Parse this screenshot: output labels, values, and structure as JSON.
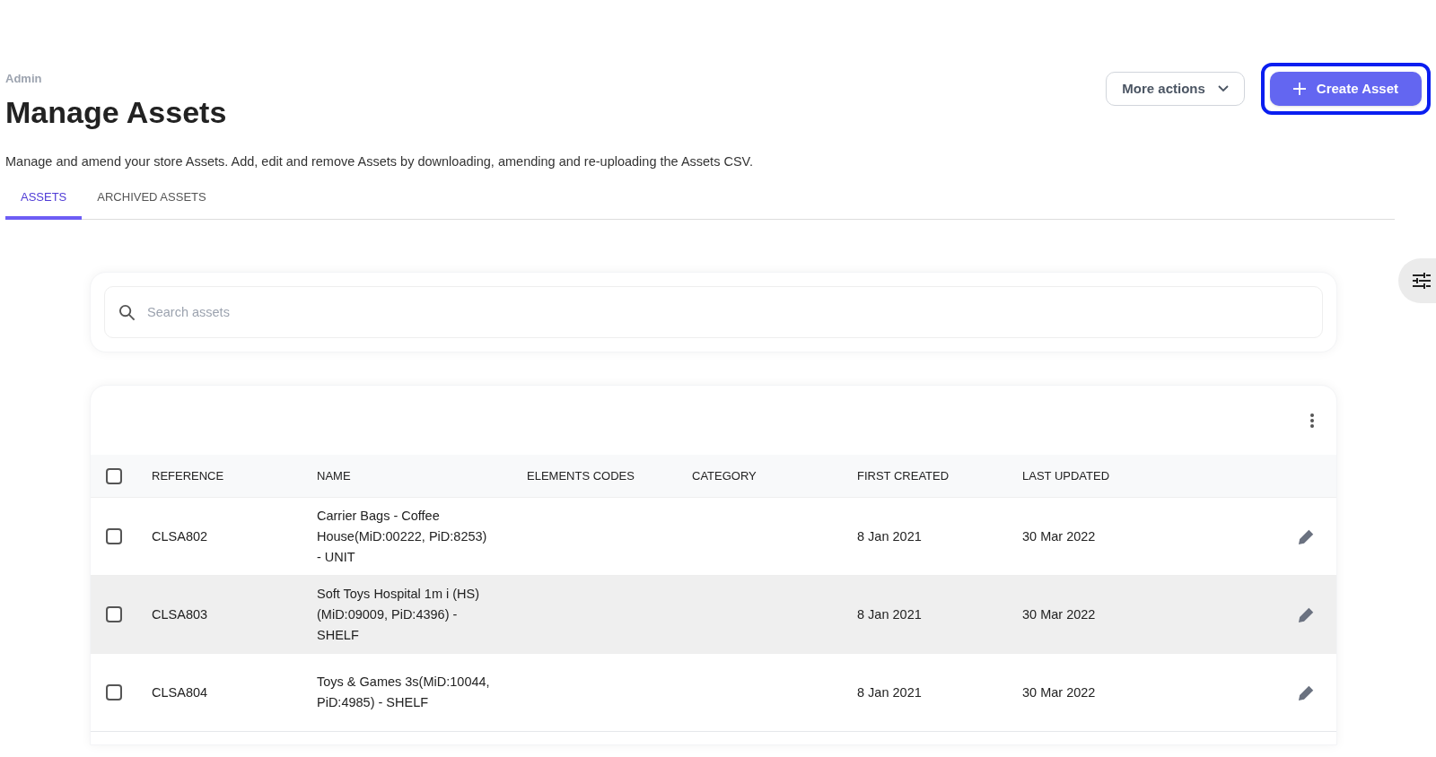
{
  "breadcrumb": "Admin",
  "title": "Manage Assets",
  "description": "Manage and amend your store Assets. Add, edit and remove Assets by downloading, amending and re-uploading the Assets CSV.",
  "actions": {
    "more": "More actions",
    "create": "Create Asset",
    "create_highlighted": true
  },
  "tabs": [
    {
      "label": "ASSETS",
      "selected": true
    },
    {
      "label": "ARCHIVED ASSETS",
      "selected": false
    }
  ],
  "search": {
    "placeholder": "Search assets"
  },
  "table": {
    "all_checked": false,
    "columns": [
      "REFERENCE",
      "NAME",
      "ELEMENTS CODES",
      "CATEGORY",
      "FIRST CREATED",
      "LAST UPDATED"
    ],
    "rows": [
      {
        "checked": false,
        "hovered": false,
        "reference": "CLSA802",
        "name": "Carrier Bags - Coffee House(MiD:00222, PiD:8253) - UNIT",
        "first_created": "8 Jan 2021",
        "last_updated": "30 Mar 2022"
      },
      {
        "checked": false,
        "hovered": true,
        "reference": "CLSA803",
        "name": "Soft Toys Hospital 1m i (HS) (MiD:09009, PiD:4396) - SHELF",
        "first_created": "8 Jan 2021",
        "last_updated": "30 Mar 2022"
      },
      {
        "checked": false,
        "hovered": false,
        "reference": "CLSA804",
        "name": "Toys & Games 3s(MiD:10044, PiD:4985) - SHELF",
        "first_created": "8 Jan 2021",
        "last_updated": "30 Mar 2022"
      }
    ]
  }
}
